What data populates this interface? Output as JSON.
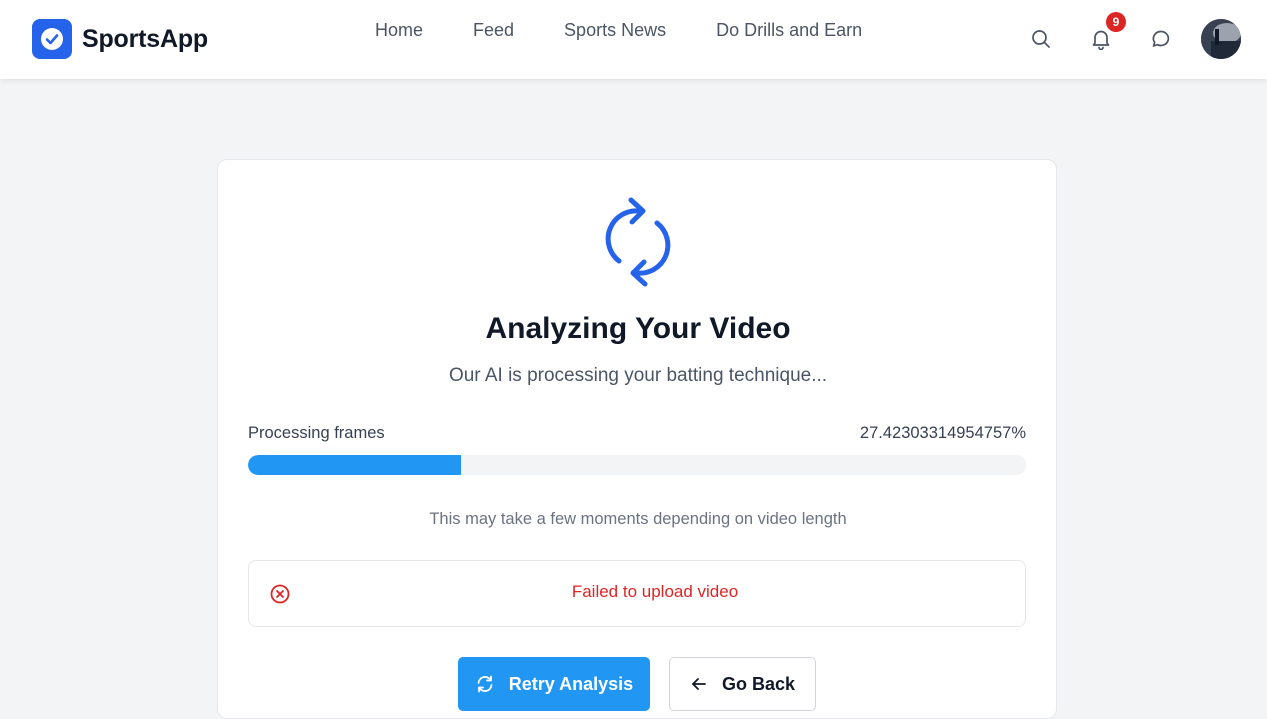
{
  "header": {
    "brand": "SportsApp",
    "nav": [
      "Home",
      "Feed",
      "Sports News",
      "Do Drills and Earn"
    ],
    "notification_count": "9",
    "icons": [
      "search-icon",
      "bell-icon",
      "chat-icon",
      "avatar"
    ]
  },
  "analysis": {
    "title": "Analyzing Your Video",
    "subtitle": "Our AI is processing your batting technique...",
    "progress_label": "Processing frames",
    "progress_value": "27.42303314954757%",
    "progress_fraction": 0.2742303314954757,
    "hint": "This may take a few moments depending on video length",
    "error_text": "Failed to upload video",
    "retry_label": "Retry Analysis",
    "back_label": "Go Back"
  },
  "colors": {
    "brand": "#2563eb",
    "progress": "#2196f3",
    "error": "#dc2626",
    "badge": "#dc2626"
  }
}
